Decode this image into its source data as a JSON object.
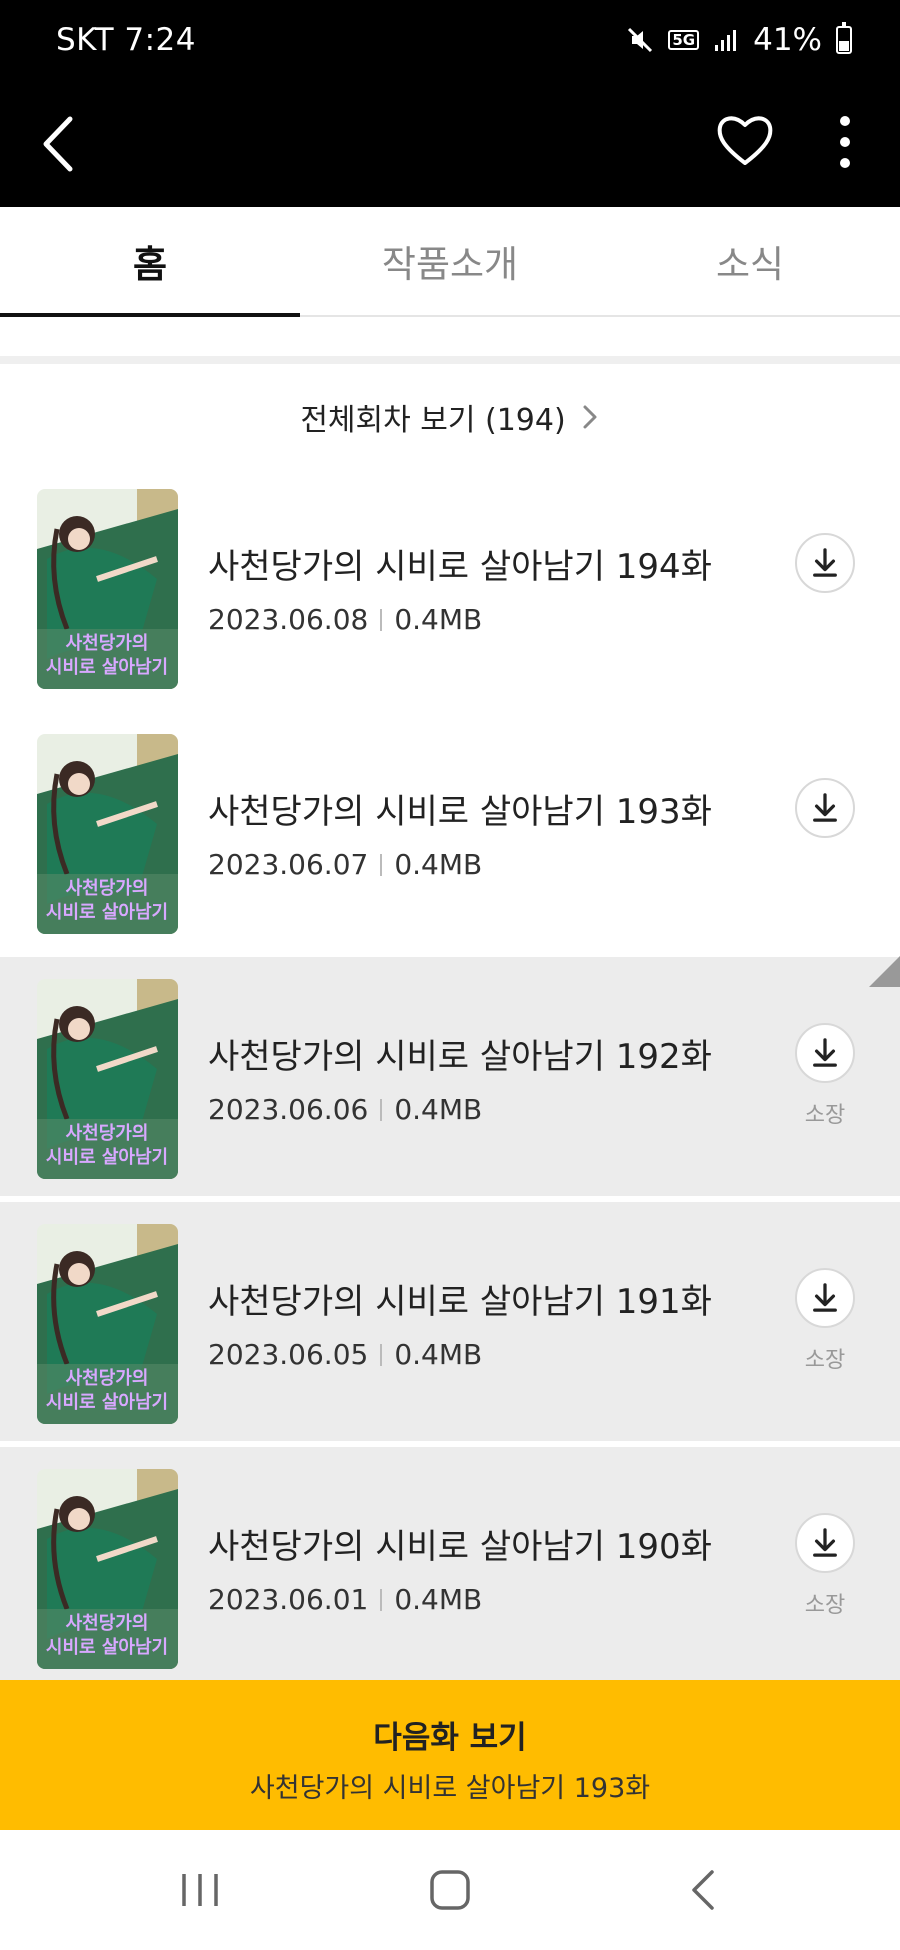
{
  "status_bar": {
    "carrier_time": "SKT 7:24",
    "network": "5G",
    "battery": "41%"
  },
  "tabs": [
    {
      "label": "홈",
      "active": true
    },
    {
      "label": "작품소개",
      "active": false
    },
    {
      "label": "소식",
      "active": false
    }
  ],
  "all_episodes": {
    "label": "전체회차 보기 (194)"
  },
  "episodes": [
    {
      "title": "사천당가의 시비로 살아남기 194화",
      "date": "2023.06.08",
      "size": "0.4MB",
      "owned_label": ""
    },
    {
      "title": "사천당가의 시비로 살아남기 193화",
      "date": "2023.06.07",
      "size": "0.4MB",
      "owned_label": ""
    },
    {
      "title": "사천당가의 시비로 살아남기 192화",
      "date": "2023.06.06",
      "size": "0.4MB",
      "owned_label": "소장"
    },
    {
      "title": "사천당가의 시비로 살아남기 191화",
      "date": "2023.06.05",
      "size": "0.4MB",
      "owned_label": "소장"
    },
    {
      "title": "사천당가의 시비로 살아남기 190화",
      "date": "2023.06.01",
      "size": "0.4MB",
      "owned_label": "소장"
    }
  ],
  "next_episode": {
    "label": "다음화 보기",
    "subtitle": "사천당가의 시비로 살아남기 193화"
  },
  "colors": {
    "accent": "#ffbc00",
    "owned_row_bg": "#ececec"
  },
  "icons": [
    "back-icon",
    "heart-icon",
    "more-icon",
    "download-icon",
    "recent-apps-icon",
    "home-icon",
    "nav-back-icon"
  ]
}
